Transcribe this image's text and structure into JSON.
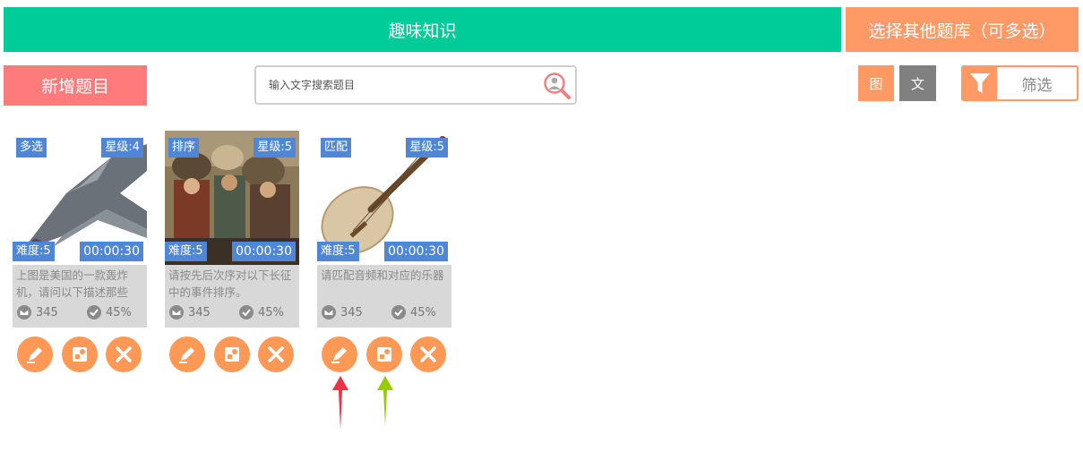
{
  "header": {
    "bank_title": "趣味知识",
    "select_other_label": "选择其他题库（可多选）"
  },
  "toolbar": {
    "new_button_label": "新增题目",
    "search_placeholder": "输入文字搜索题目",
    "view_image_label": "图",
    "view_text_label": "文",
    "filter_label": "筛选"
  },
  "colors": {
    "green": "#00cc99",
    "orange": "#ff9966",
    "salmon": "#ff7b7b",
    "tag_blue": "#4f86d6",
    "arrow_red": "#ee3344",
    "arrow_green": "#99cc00"
  },
  "cards": [
    {
      "type": "多选",
      "stars": "星级:4",
      "difficulty": "难度:5",
      "duration": "00:00:30",
      "description": "上图是美国的一款轰炸机，请问以下描述那些",
      "views": "345",
      "accuracy": "45%",
      "image": "bomber-plane"
    },
    {
      "type": "排序",
      "stars": "星级:5",
      "difficulty": "难度:5",
      "duration": "00:00:30",
      "description": "请按先后次序对以下长征中的事件排序。",
      "views": "345",
      "accuracy": "45%",
      "image": "historical-painting"
    },
    {
      "type": "匹配",
      "stars": "星级:5",
      "difficulty": "难度:5",
      "duration": "00:00:30",
      "description": "请匹配音频和对应的乐器",
      "views": "345",
      "accuracy": "45%",
      "image": "pipa-instrument"
    }
  ],
  "icons": [
    "search-user-icon",
    "filter-funnel-icon",
    "views-icon",
    "accuracy-check-icon",
    "edit-pencil-icon",
    "copy-icon",
    "delete-x-icon",
    "up-arrow-annotation"
  ]
}
